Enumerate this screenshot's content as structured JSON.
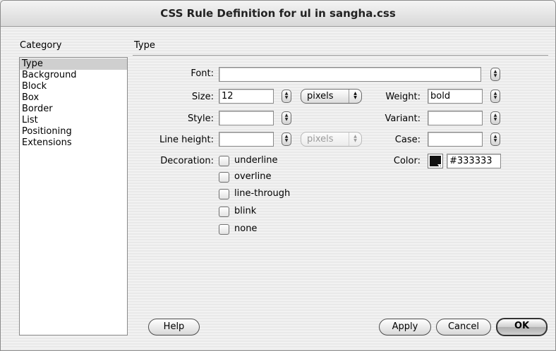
{
  "window": {
    "title": "CSS Rule Definition for ul in sangha.css"
  },
  "category": {
    "header": "Category",
    "items": [
      "Type",
      "Background",
      "Block",
      "Box",
      "Border",
      "List",
      "Positioning",
      "Extensions"
    ],
    "selected": "Type"
  },
  "panel": {
    "header": "Type"
  },
  "labels": {
    "font": "Font:",
    "size": "Size:",
    "style": "Style:",
    "line_height": "Line height:",
    "decoration": "Decoration:",
    "weight": "Weight:",
    "variant": "Variant:",
    "case": "Case:",
    "color": "Color:"
  },
  "values": {
    "font": "",
    "size": "12",
    "size_unit": "pixels",
    "style": "",
    "line_height": "",
    "line_height_unit": "pixels",
    "weight": "bold",
    "variant": "",
    "case": "",
    "color": "#333333"
  },
  "decoration_options": [
    "underline",
    "overline",
    "line-through",
    "blink",
    "none"
  ],
  "buttons": {
    "help": "Help",
    "apply": "Apply",
    "cancel": "Cancel",
    "ok": "OK"
  },
  "icons": {
    "stepper": "up-down-stepper-icon",
    "popup": "popup-arrows-icon",
    "color": "color-swatch-icon"
  },
  "colors": {
    "swatch": "#111111",
    "selection": "#cfcfcf"
  }
}
